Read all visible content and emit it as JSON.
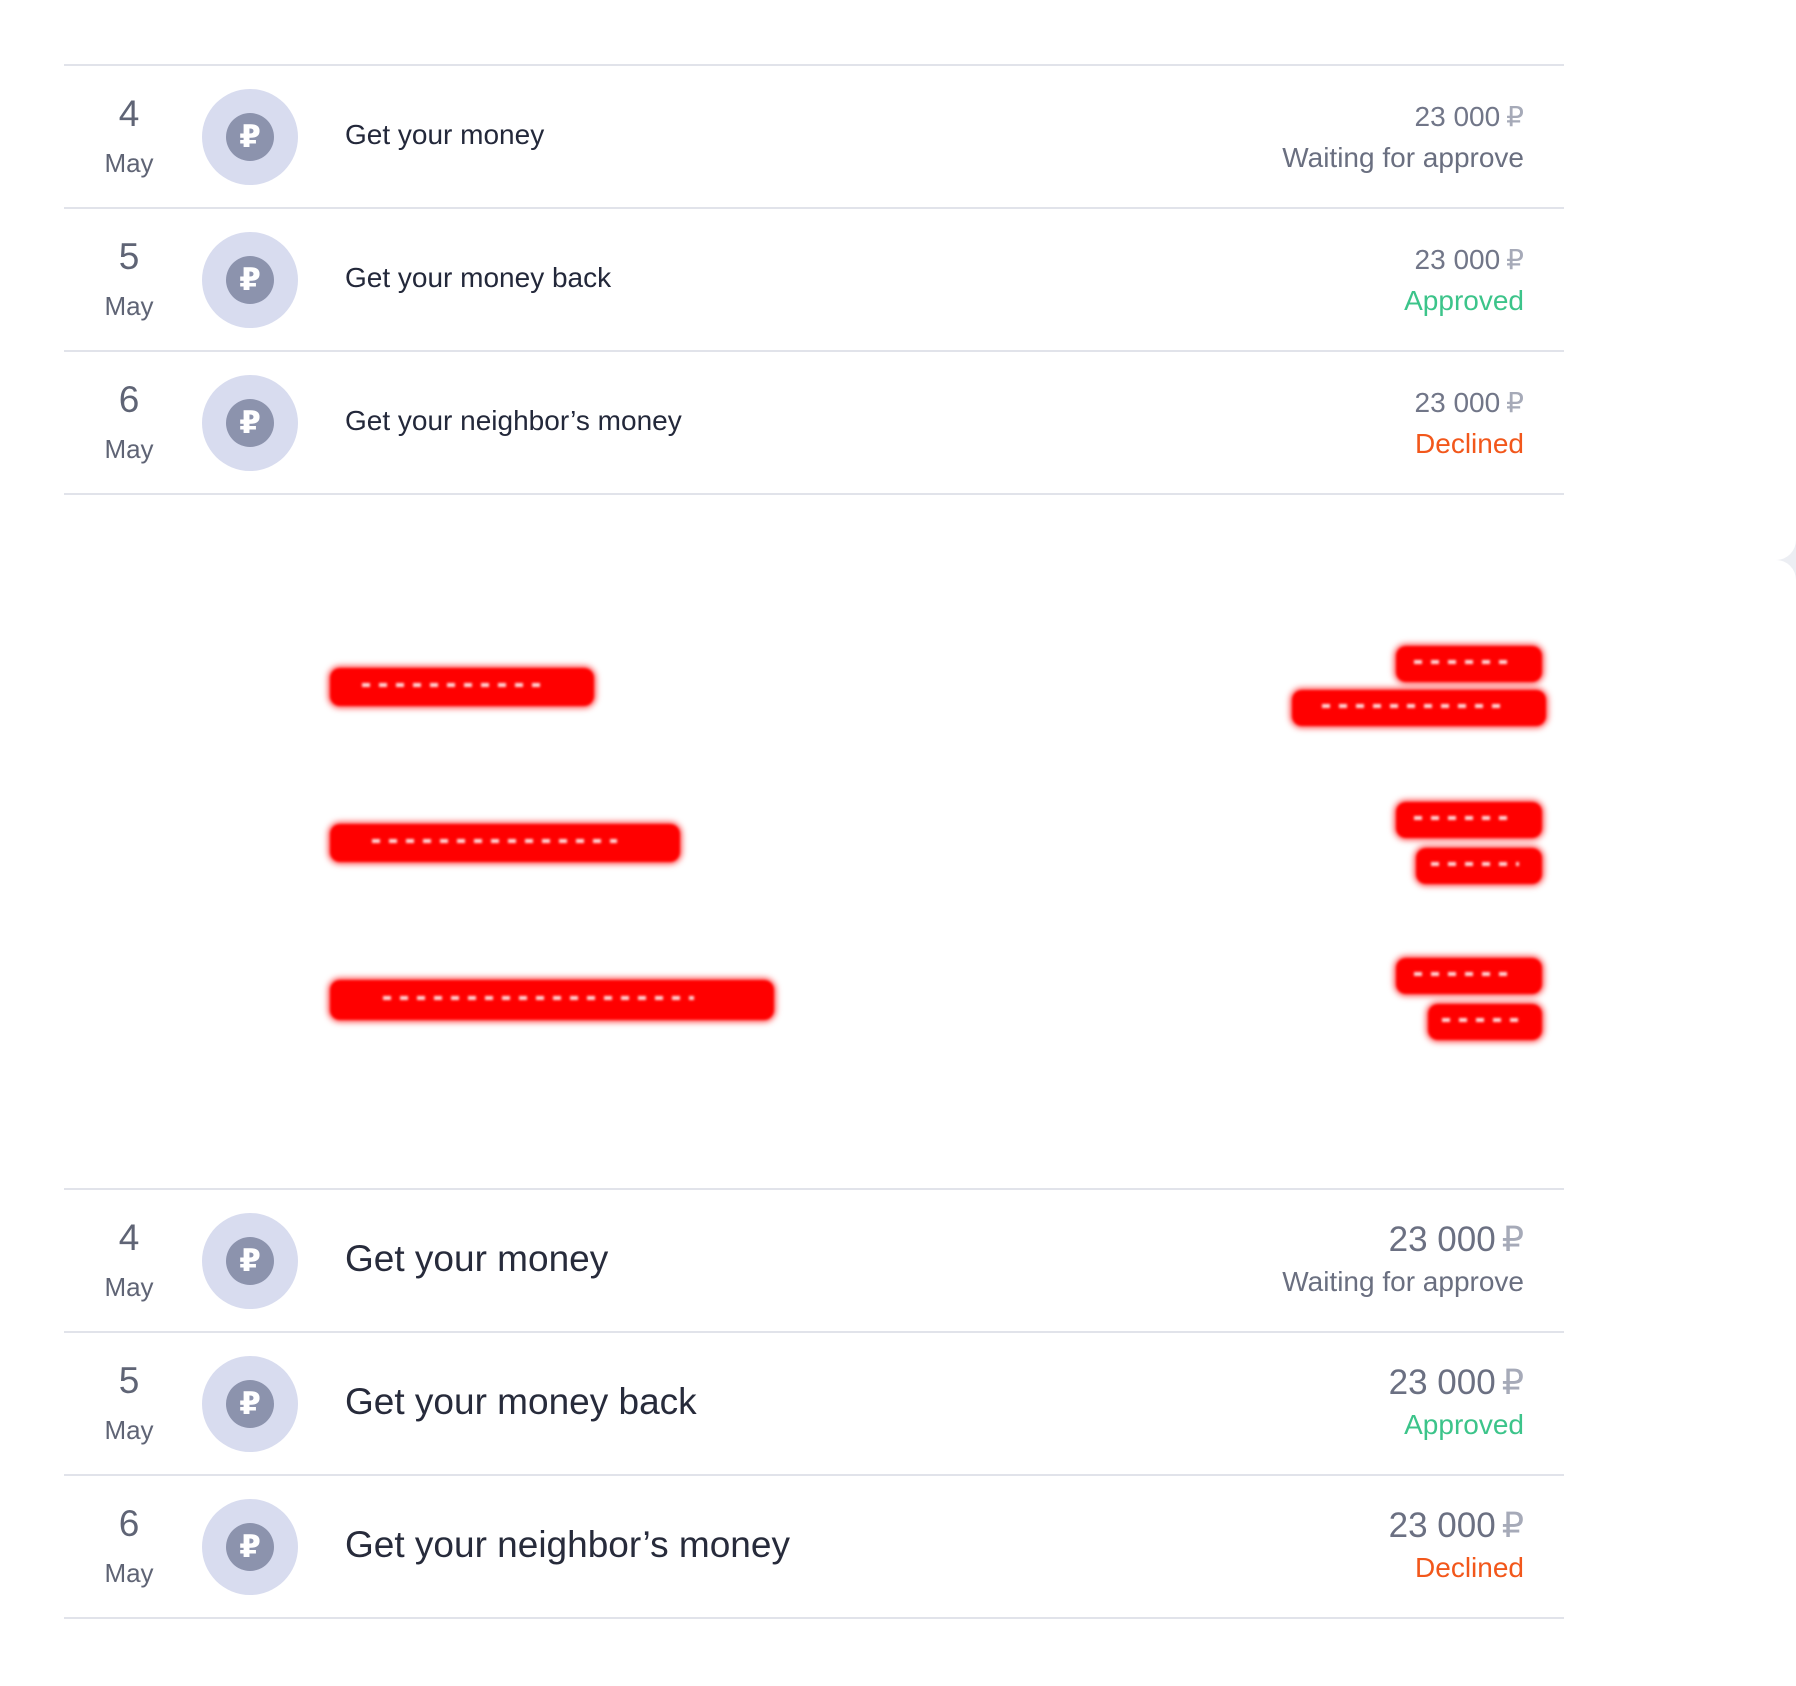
{
  "colors": {
    "approved": "#3cc48a",
    "declined": "#f2571b",
    "waiting": "#6a6f80",
    "redaction": "#ff0000",
    "avatar_bg": "#d8dcef",
    "coin": "#8c93ad"
  },
  "icons": {
    "transaction": "ruble-coin-icon"
  },
  "top_list": {
    "rows": [
      {
        "day": "4",
        "month": "May",
        "title": "Get your money",
        "amount": "23 000",
        "currency": "₽",
        "status": "Waiting for approve",
        "status_kind": "waiting"
      },
      {
        "day": "5",
        "month": "May",
        "title": "Get your money back",
        "amount": "23 000",
        "currency": "₽",
        "status": "Approved",
        "status_kind": "approved"
      },
      {
        "day": "6",
        "month": "May",
        "title": "Get your neighbor’s money",
        "amount": "23 000",
        "currency": "₽",
        "status": "Declined",
        "status_kind": "declined"
      }
    ]
  },
  "bottom_list": {
    "rows": [
      {
        "day": "4",
        "month": "May",
        "title": "Get your money",
        "amount": "23 000",
        "currency": "₽",
        "status": "Waiting for approve",
        "status_kind": "waiting"
      },
      {
        "day": "5",
        "month": "May",
        "title": "Get your money back",
        "amount": "23 000",
        "currency": "₽",
        "status": "Approved",
        "status_kind": "approved"
      },
      {
        "day": "6",
        "month": "May",
        "title": "Get your neighbor’s money",
        "amount": "23 000",
        "currency": "₽",
        "status": "Declined",
        "status_kind": "declined"
      }
    ]
  },
  "coin_glyph": "₽"
}
